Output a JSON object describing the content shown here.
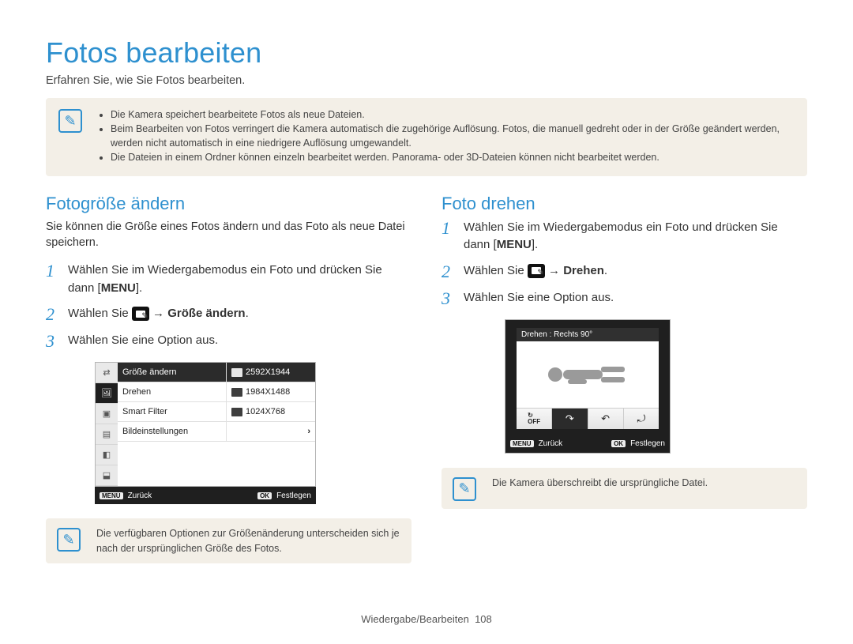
{
  "title": "Fotos bearbeiten",
  "subtitle": "Erfahren Sie, wie Sie Fotos bearbeiten.",
  "topNote": {
    "bullets": [
      "Die Kamera speichert bearbeitete Fotos als neue Dateien.",
      "Beim Bearbeiten von Fotos verringert die Kamera automatisch die zugehörige Auflösung. Fotos, die manuell gedreht oder in der Größe geändert werden, werden nicht automatisch in eine niedrigere Auflösung umgewandelt.",
      "Die Dateien in einem Ordner können einzeln bearbeitet werden. Panorama- oder 3D-Dateien können nicht bearbeitet werden."
    ]
  },
  "left": {
    "heading": "Fotogröße ändern",
    "lead": "Sie können die Größe eines Fotos ändern und das Foto als neue Datei speichern.",
    "step1_a": "Wählen Sie im Wiedergabemodus ein Foto und drücken Sie dann [",
    "step1_menu": "MENU",
    "step1_b": "].",
    "step2_a": "Wählen Sie ",
    "step2_arrow": " → ",
    "step2_target": "Größe ändern",
    "step2_b": ".",
    "step3": "Wählen Sie eine Option aus.",
    "note": "Die verfügbaren Optionen zur Größenänderung unterscheiden sich je nach der ursprünglichen Größe des Fotos."
  },
  "right": {
    "heading": "Foto drehen",
    "step1_a": "Wählen Sie im Wiedergabemodus ein Foto und drücken Sie dann [",
    "step1_menu": "MENU",
    "step1_b": "].",
    "step2_a": "Wählen Sie ",
    "step2_arrow": " → ",
    "step2_target": "Drehen",
    "step2_b": ".",
    "step3": "Wählen Sie eine Option aus.",
    "note": "Die Kamera überschreibt die ursprüngliche Datei."
  },
  "camMenu": {
    "rows": [
      {
        "label": "Größe ändern",
        "value": "2592X1944",
        "hl": true
      },
      {
        "label": "Drehen",
        "value": "1984X1488",
        "hl": false
      },
      {
        "label": "Smart Filter",
        "value": "1024X768",
        "hl": false
      },
      {
        "label": "Bildeinstellungen",
        "value": "",
        "arrow": true,
        "hl": false
      }
    ],
    "footer": {
      "backChip": "MENU",
      "back": "Zurück",
      "okChip": "OK",
      "ok": "Festlegen"
    }
  },
  "rotate": {
    "title": "Drehen : Rechts 90°",
    "buttons": [
      "OFF",
      "↷",
      "↶",
      "⤾"
    ],
    "footer": {
      "backChip": "MENU",
      "back": "Zurück",
      "okChip": "OK",
      "ok": "Festlegen"
    }
  },
  "footer": {
    "section": "Wiedergabe/Bearbeiten",
    "page": "108"
  },
  "nums": {
    "n1": "1",
    "n2": "2",
    "n3": "3"
  }
}
